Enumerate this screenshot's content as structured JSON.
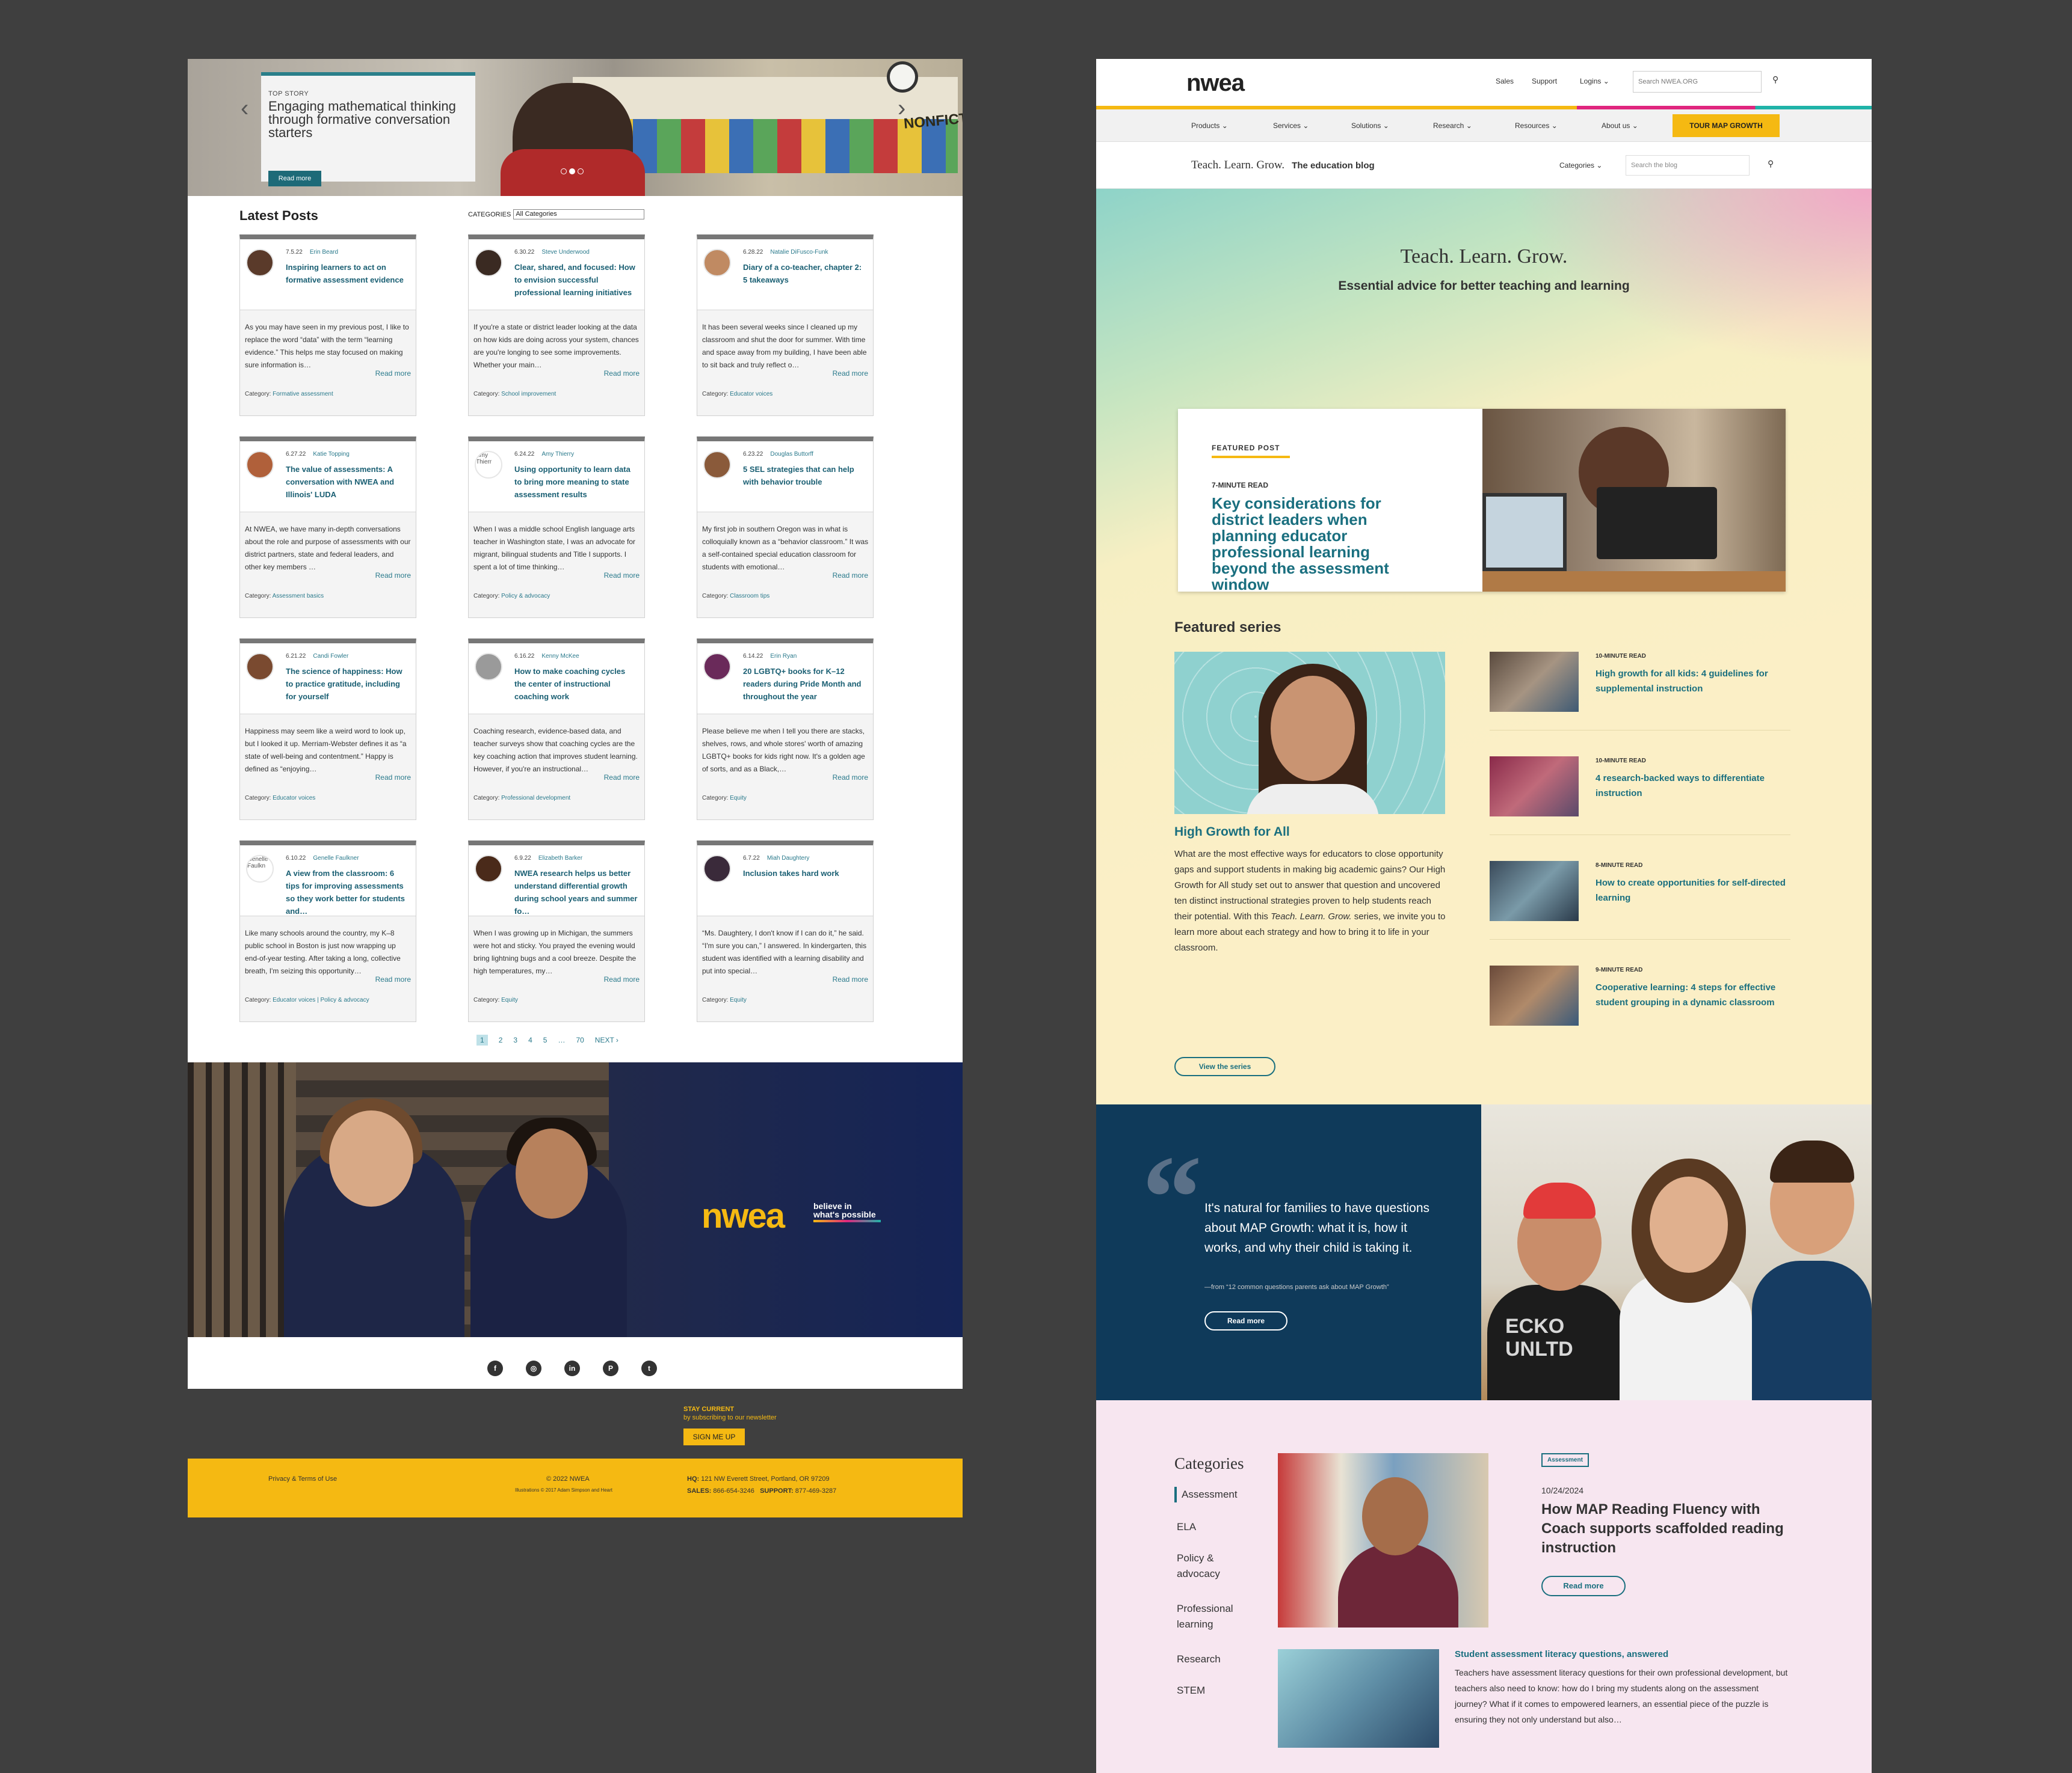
{
  "left_page": {
    "hero": {
      "label": "TOP STORY",
      "title": "Engaging mathematical thinking through formative conversation starters",
      "button": "Read more",
      "wall_sign": "NONFICT"
    },
    "latest_posts_heading": "Latest Posts",
    "categories_label": "CATEGORIES",
    "categories_select": "All Categories",
    "posts": [
      {
        "date": "7.5.22",
        "author": "Erin Beard",
        "title": "Inspiring learners to act on formative assessment evidence",
        "excerpt": "As you may have seen in my previous post, I like to replace the word “data” with the term “learning evidence.” This helps me stay focused on making sure information is…",
        "read_more": "Read more",
        "category_label": "Category:",
        "category": "Formative assessment"
      },
      {
        "date": "6.30.22",
        "author": "Steve Underwood",
        "title": "Clear, shared, and focused: How to envision successful professional learning initiatives",
        "excerpt": "If you're a state or district leader looking at the data on how kids are doing across your system, chances are you're longing to see some improvements. Whether your main…",
        "read_more": "Read more",
        "category_label": "Category:",
        "category": "School improvement"
      },
      {
        "date": "6.28.22",
        "author": "Natalie DiFusco-Funk",
        "title": "Diary of a co-teacher, chapter 2: 5 takeaways",
        "excerpt": "It has been several weeks since I cleaned up my classroom and shut the door for summer. With time and space away from my building, I have been able to sit back and truly reflect o…",
        "read_more": "Read more",
        "category_label": "Category:",
        "category": "Educator voices"
      },
      {
        "date": "6.27.22",
        "author": "Katie Topping",
        "title": "The value of assessments: A conversation with NWEA and Illinois' LUDA",
        "excerpt": "At NWEA, we have many in-depth conversations about the role and purpose of assessments with our district partners, state and federal leaders, and other key members …",
        "read_more": "Read more",
        "category_label": "Category:",
        "category": "Assessment basics"
      },
      {
        "date": "6.24.22",
        "author": "Amy Thierry",
        "avatar_alt": "Amy Thierr",
        "title": "Using opportunity to learn data to bring more meaning to state assessment results",
        "excerpt": "When I was a middle school English language arts teacher in Washington state, I was an advocate for migrant, bilingual students and Title I supports. I spent a lot of time thinking…",
        "read_more": "Read more",
        "category_label": "Category:",
        "category": "Policy & advocacy"
      },
      {
        "date": "6.23.22",
        "author": "Douglas Buttorff",
        "title": "5 SEL strategies that can help with behavior trouble",
        "excerpt": "My first job in southern Oregon was in what is colloquially known as a “behavior classroom.” It was a self-contained special education classroom for students with emotional…",
        "read_more": "Read more",
        "category_label": "Category:",
        "category": "Classroom tips"
      },
      {
        "date": "6.21.22",
        "author": "Candi Fowler",
        "title": "The science of happiness: How to practice gratitude, including for yourself",
        "excerpt": "Happiness may seem like a weird word to look up, but I looked it up. Merriam-Webster defines it as “a state of well-being and contentment.” Happy is defined as “enjoying…",
        "read_more": "Read more",
        "category_label": "Category:",
        "category": "Educator voices"
      },
      {
        "date": "6.16.22",
        "author": "Kenny McKee",
        "title": "How to make coaching cycles the center of instructional coaching work",
        "excerpt": "Coaching research, evidence-based data, and teacher surveys show that coaching cycles are the key coaching action that improves student learning. However, if you're an instructional…",
        "read_more": "Read more",
        "category_label": "Category:",
        "category": "Professional development"
      },
      {
        "date": "6.14.22",
        "author": "Erin Ryan",
        "title": "20 LGBTQ+ books for K–12 readers during Pride Month and throughout the year",
        "excerpt": "Please believe me when I tell you there are stacks, shelves, rows, and whole stores' worth of amazing LGBTQ+ books for kids right now. It's a golden age of sorts, and as a Black,…",
        "read_more": "Read more",
        "category_label": "Category:",
        "category": "Equity"
      },
      {
        "date": "6.10.22",
        "author": "Genelle Faulkner",
        "avatar_alt": "Genelle Faulkn",
        "title": "A view from the classroom: 6 tips for improving assessments so they work better for students and…",
        "excerpt": "Like many schools around the country, my K–8 public school in Boston is just now wrapping up end-of-year testing. After taking a long, collective breath, I'm seizing this opportunity…",
        "read_more": "Read more",
        "category_label": "Category:",
        "category": "Educator voices | Policy & advocacy"
      },
      {
        "date": "6.9.22",
        "author": "Elizabeth Barker",
        "title": "NWEA research helps us better understand differential growth during school years and summer fo…",
        "excerpt": "When I was growing up in Michigan, the summers were hot and sticky. You prayed the evening would bring lightning bugs and a cool breeze. Despite the high temperatures, my…",
        "read_more": "Read more",
        "category_label": "Category:",
        "category": "Equity"
      },
      {
        "date": "6.7.22",
        "author": "Miah Daughtery",
        "title": "Inclusion takes hard work",
        "excerpt": "“Ms. Daughtery, I don't know if I can do it,” he said. “I'm sure you can,” I answered. In kindergarten, this student was identified with a learning disability and put into special…",
        "read_more": "Read more",
        "category_label": "Category:",
        "category": "Equity"
      }
    ],
    "pagination": [
      "1",
      "2",
      "3",
      "4",
      "5",
      "…",
      "70",
      "NEXT ›"
    ],
    "banner": {
      "logo": "nwea",
      "tagline_1": "believe in",
      "tagline_2": "what's possible"
    },
    "social": [
      {
        "icon": "facebook-icon",
        "glyph": "f"
      },
      {
        "icon": "instagram-icon",
        "glyph": "◎"
      },
      {
        "icon": "linkedin-icon",
        "glyph": "in"
      },
      {
        "icon": "pinterest-icon",
        "glyph": "P"
      },
      {
        "icon": "twitter-icon",
        "glyph": "t"
      }
    ],
    "footer": {
      "stay_current": "STAY CURRENT",
      "subscribe": "by subscribing to our newsletter",
      "sign_me_up": "SIGN ME UP",
      "privacy": "Privacy & Terms of Use",
      "copyright": "© 2022 NWEA",
      "illustrations": "Illustrations © 2017 Adam Simpson and Heart",
      "hq_label": "HQ:",
      "hq": "121 NW Everett Street, Portland, OR 97209",
      "sales_label": "SALES:",
      "sales": "866-654-3246",
      "support_label": "SUPPORT:",
      "support": "877-469-3287"
    }
  },
  "right_page": {
    "logo": "nwea",
    "util_links": [
      "Sales",
      "Support",
      "Logins"
    ],
    "search_placeholder": "Search NWEA.ORG",
    "nav": [
      "Products",
      "Services",
      "Solutions",
      "Research",
      "Resources",
      "About us"
    ],
    "tour_button": "TOUR MAP GROWTH",
    "blog_title": "Teach. Learn. Grow.",
    "blog_subtitle": "The education blog",
    "categories_dropdown": "Categories",
    "blog_search_placeholder": "Search the blog",
    "hero_title": "Teach. Learn. Grow.",
    "hero_subtitle": "Essential advice for better teaching and learning",
    "featured_post": {
      "label": "FEATURED POST",
      "read_time": "7-MINUTE READ",
      "title": "Key considerations for district leaders when planning educator professional learning beyond the assessment window"
    },
    "featured_series": {
      "heading": "Featured series",
      "title": "High Growth for All",
      "body_1": "What are the most effective ways for educators to close opportunity gaps and support students in making big academic gains? Our High Growth for All study set out to answer that question and uncovered ten distinct instructional strategies proven to help students reach their potential. With this ",
      "body_em": "Teach. Learn. Grow.",
      "body_2": " series, we invite you to learn more about each strategy and how to bring it to life in your classroom.",
      "button": "View the series",
      "items": [
        {
          "read_time": "10-MINUTE READ",
          "title": "High growth for all kids: 4 guidelines for supplemental instruction"
        },
        {
          "read_time": "10-MINUTE READ",
          "title": "4 research-backed ways to differentiate instruction"
        },
        {
          "read_time": "8-MINUTE READ",
          "title": "How to create opportunities for self-directed learning"
        },
        {
          "read_time": "9-MINUTE READ",
          "title": "Cooperative learning: 4 steps for effective student grouping in a dynamic classroom"
        }
      ]
    },
    "quote": {
      "text": "It's natural for families to have questions about MAP Growth: what it is, how it works, and why their child is taking it.",
      "source": "—from “12 common questions parents ask about MAP Growth”",
      "button": "Read more",
      "shirt_text": "ECKO UNLTD"
    },
    "categories": {
      "heading": "Categories",
      "items": [
        "Assessment",
        "ELA",
        "Policy & advocacy",
        "Professional learning",
        "Research",
        "STEM"
      ],
      "article": {
        "tag": "Assessment",
        "date": "10/24/2024",
        "title": "How MAP Reading Fluency with Coach supports scaffolded reading instruction",
        "button": "Read more"
      },
      "article2": {
        "title": "Student assessment literacy questions, answered",
        "excerpt": "Teachers have assessment literacy questions for their own professional development, but teachers also need to know: how do I bring my students along on the assessment journey? What if it comes to empowered learners, an essential piece of the puzzle is ensuring they not only understand but also…"
      }
    }
  },
  "colors": {
    "brand_yellow": "#f5b912",
    "teal": "#1a6f7f",
    "navy": "#0f3a5a",
    "pink": "#e0267e",
    "aqua": "#1fb3a8"
  }
}
